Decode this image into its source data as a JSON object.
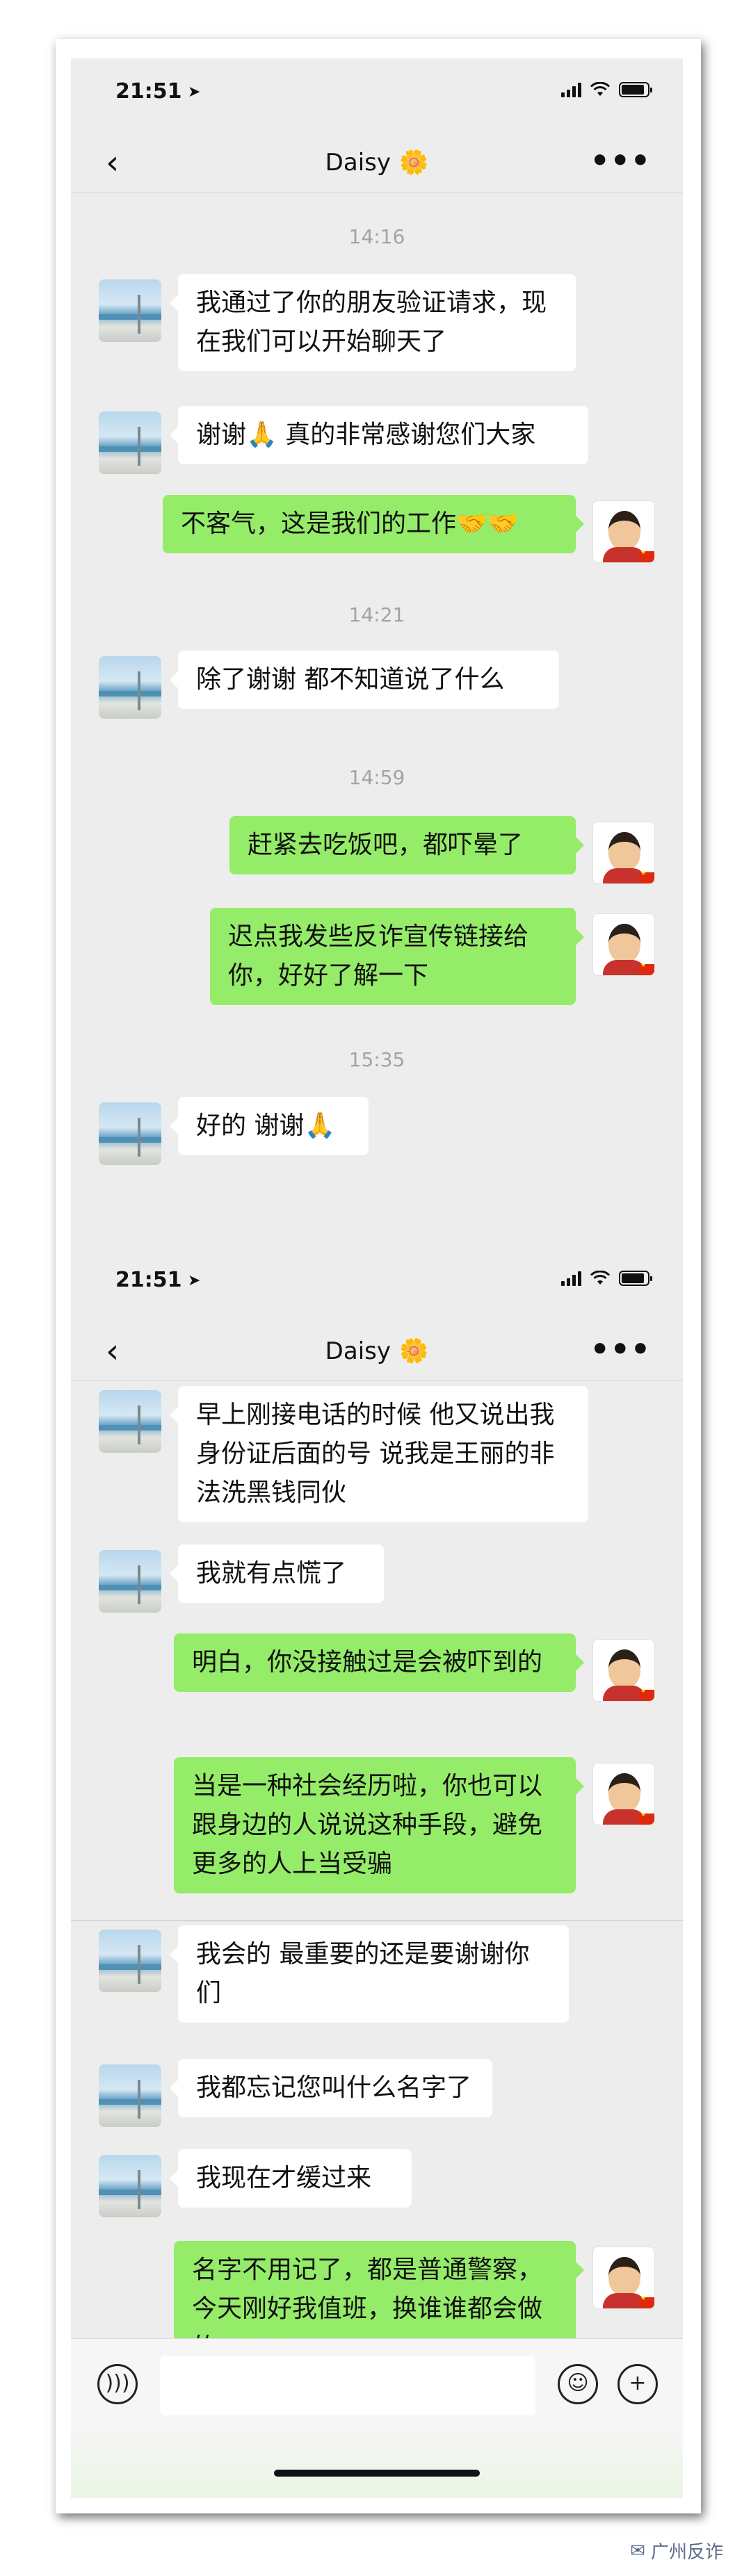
{
  "screen1": {
    "status": {
      "time": "21:51"
    },
    "nav": {
      "back": "‹",
      "title": "Daisy",
      "title_emoji": "🌼",
      "more": "•••"
    },
    "timestamps": [
      "14:16",
      "14:21",
      "14:59",
      "15:35"
    ],
    "messages": [
      {
        "side": "in",
        "text": "我通过了你的朋友验证请求，现在我们可以开始聊天了"
      },
      {
        "side": "in",
        "text": "谢谢🙏 真的非常感谢您们大家"
      },
      {
        "side": "out",
        "text": "不客气，这是我们的工作🤝🤝"
      },
      {
        "side": "in",
        "text": "除了谢谢 都不知道说了什么"
      },
      {
        "side": "out",
        "text": "赶紧去吃饭吧，都吓晕了"
      },
      {
        "side": "out",
        "text": "迟点我发些反诈宣传链接给你，好好了解一下"
      },
      {
        "side": "in",
        "text": "好的 谢谢🙏"
      }
    ]
  },
  "screen2": {
    "status": {
      "time": "21:51"
    },
    "nav": {
      "back": "‹",
      "title": "Daisy",
      "title_emoji": "🌼",
      "more": "•••"
    },
    "messages": [
      {
        "side": "in",
        "text": "早上刚接电话的时候 他又说出我身份证后面的号 说我是王丽的非法洗黑钱同伙"
      },
      {
        "side": "in",
        "text": "我就有点慌了"
      },
      {
        "side": "out",
        "text": "明白，你没接触过是会被吓到的"
      },
      {
        "side": "out",
        "text": "当是一种社会经历啦，你也可以跟身边的人说说这种手段，避免更多的人上当受骗"
      },
      {
        "side": "in",
        "text": "我会的 最重要的还是要谢谢你们"
      },
      {
        "side": "in",
        "text": "我都忘记您叫什么名字了"
      },
      {
        "side": "in",
        "text": "我现在才缓过来"
      },
      {
        "side": "out",
        "text": "名字不用记了，都是普通警察，今天刚好我值班，换谁谁都会做的🤝🤝"
      }
    ]
  },
  "input_bar": {
    "voice_icon": "voice-icon",
    "emoji_icon": "emoji-icon",
    "plus_icon": "plus-icon"
  },
  "watermark": {
    "text": "广州反诈"
  }
}
